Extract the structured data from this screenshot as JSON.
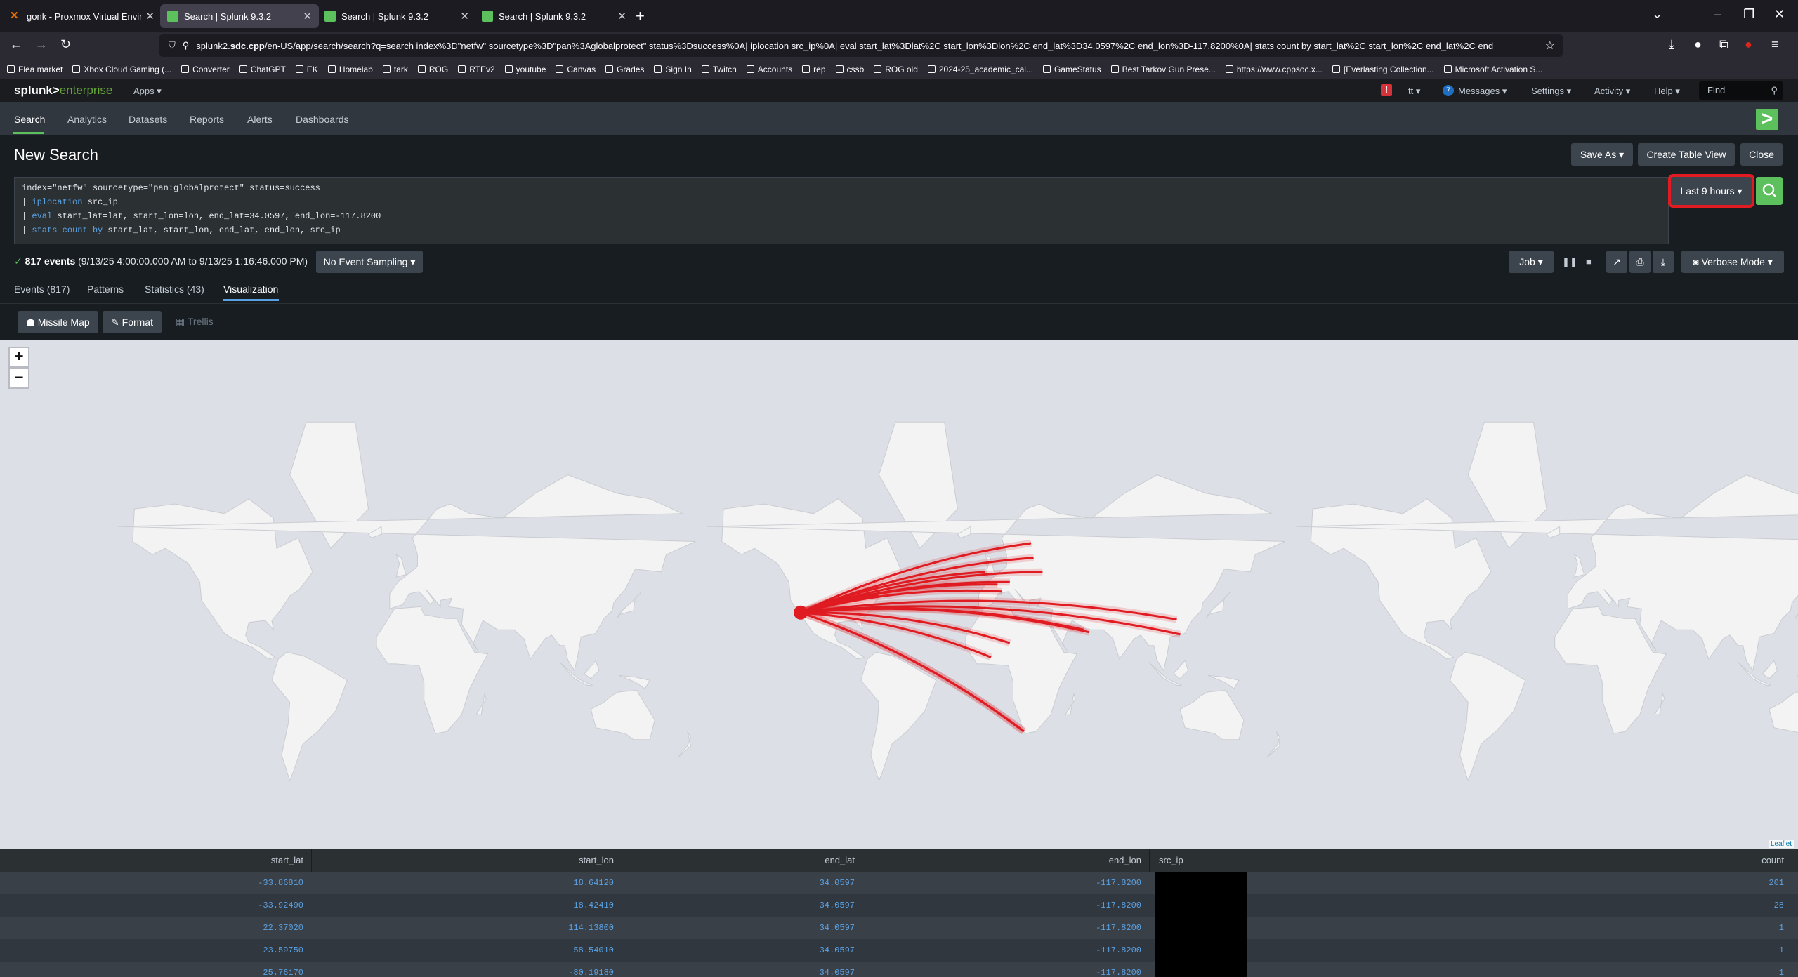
{
  "browser": {
    "tabs": [
      {
        "title": "gonk - Proxmox Virtual Environ",
        "color": "#e57000",
        "active": false
      },
      {
        "title": "Search | Splunk 9.3.2",
        "color": "#5cc05c",
        "active": true
      },
      {
        "title": "Search | Splunk 9.3.2",
        "color": "#5cc05c",
        "active": false
      },
      {
        "title": "Search | Splunk 9.3.2",
        "color": "#5cc05c",
        "active": false
      }
    ],
    "url_prefix": "splunk2.",
    "url_host": "sdc.cpp",
    "url_rest": "/en-US/app/search/search?q=search index%3D\"netfw\" sourcetype%3D\"pan%3Aglobalprotect\" status%3Dsuccess%0A| iplocation src_ip%0A| eval start_lat%3Dlat%2C start_lon%3Dlon%2C end_lat%3D34.0597%2C end_lon%3D-117.8200%0A| stats count by start_lat%2C start_lon%2C end_lat%2C end",
    "bookmarks": [
      "Flea market",
      "Xbox Cloud Gaming (...",
      "Converter",
      "ChatGPT",
      "EK",
      "Homelab",
      "tark",
      "ROG",
      "RTEv2",
      "youtube",
      "Canvas",
      "Grades",
      "Sign In",
      "Twitch",
      "Accounts",
      "rep",
      "cssb",
      "ROG old",
      "2024-25_academic_cal...",
      "GameStatus",
      "Best Tarkov Gun Prese...",
      "https://www.cppsoc.x...",
      "[Everlasting Collection...",
      "Microsoft Activation S..."
    ]
  },
  "splunk": {
    "logo_main": "splunk>",
    "logo_sub": "enterprise",
    "apps_label": "Apps ▾",
    "user_label": "tt ▾",
    "messages_count": "7",
    "messages_label": "Messages ▾",
    "settings_label": "Settings ▾",
    "activity_label": "Activity ▾",
    "help_label": "Help ▾",
    "find_placeholder": "Find",
    "alert_badge": "!",
    "nav": [
      "Search",
      "Analytics",
      "Datasets",
      "Reports",
      "Alerts",
      "Dashboards"
    ],
    "nav_active": "Search"
  },
  "search": {
    "page_title": "New Search",
    "save_as": "Save As ▾",
    "create_table_view": "Create Table View",
    "close": "Close",
    "query_line1": "index=\"netfw\" sourcetype=\"pan:globalprotect\" status=success",
    "query_line2_kw": "iplocation",
    "query_line2_rest": " src_ip",
    "query_line3_kw": "eval",
    "query_line3_rest": " start_lat=lat, start_lon=lon, end_lat=34.0597, end_lon=-117.8200",
    "query_line4_kw": "stats count",
    "query_line4_by": "by",
    "query_line4_rest": " start_lat, start_lon, end_lat, end_lon, src_ip",
    "pipe": "| ",
    "time_range": "Last 9 hours ▾",
    "events_count": "817 events",
    "events_range": "(9/13/25 4:00:00.000 AM to 9/13/25 1:16:46.000 PM)",
    "sampling": "No Event Sampling ▾",
    "job": "Job ▾",
    "mode": "Verbose Mode ▾"
  },
  "result_tabs": [
    "Events (817)",
    "Patterns",
    "Statistics (43)",
    "Visualization"
  ],
  "result_tab_active": "Visualization",
  "viz_toolbar": {
    "type": "Missile Map",
    "format": "Format",
    "trellis": "Trellis"
  },
  "map": {
    "zoom_in": "+",
    "zoom_out": "−",
    "attribution": "Leaflet",
    "destination": {
      "lat": 34.0597,
      "lon": -117.82
    },
    "sources": [
      {
        "lat": 61.5,
        "lon": 23.0
      },
      {
        "lat": 57.0,
        "lon": 24.5
      },
      {
        "lat": 52.0,
        "lon": 30.0
      },
      {
        "lat": 48.0,
        "lon": 10.0
      },
      {
        "lat": 47.0,
        "lon": 2.5
      },
      {
        "lat": 44.0,
        "lon": 5.0
      },
      {
        "lat": 52.0,
        "lon": -5.0
      },
      {
        "lat": 42.0,
        "lon": -70.0
      },
      {
        "lat": 30.5,
        "lon": 112.0
      },
      {
        "lat": 22.3702,
        "lon": 114.138
      },
      {
        "lat": 23.5975,
        "lon": 58.5401
      },
      {
        "lat": 25.0,
        "lon": 55.0
      },
      {
        "lat": 17.5,
        "lon": 10.0
      },
      {
        "lat": 9.0,
        "lon": -1.5
      },
      {
        "lat": -33.9249,
        "lon": 18.4241
      },
      {
        "lat": -33.8681,
        "lon": 18.6412
      }
    ],
    "colors": {
      "ocean": "#dce0e6",
      "land": "#f3f3f3",
      "arc": "#e01b22"
    }
  },
  "table": {
    "headers": [
      "start_lat",
      "start_lon",
      "end_lat",
      "end_lon",
      "src_ip",
      "count"
    ],
    "rows": [
      [
        "-33.86810",
        "18.64120",
        "34.0597",
        "-117.8200",
        "",
        "201"
      ],
      [
        "-33.92490",
        "18.42410",
        "34.0597",
        "-117.8200",
        "",
        "28"
      ],
      [
        "22.37020",
        "114.13800",
        "34.0597",
        "-117.8200",
        "",
        "1"
      ],
      [
        "23.59750",
        "58.54010",
        "34.0597",
        "-117.8200",
        "",
        "1"
      ],
      [
        "25.76170",
        "-80.19180",
        "34.0597",
        "-117.8200",
        "",
        "1"
      ]
    ]
  }
}
